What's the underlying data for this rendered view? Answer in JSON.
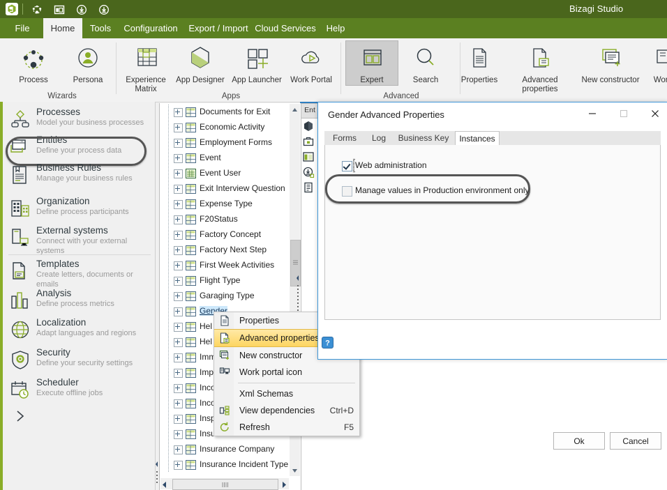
{
  "app": {
    "title": "Bizagi Studio",
    "titlebar_icons": [
      "bizagi-logo-icon",
      "process-icon",
      "window-layout-icon",
      "download-icon",
      "download-alt-icon"
    ]
  },
  "ribbon": {
    "tabs": [
      {
        "label": "File",
        "active": false
      },
      {
        "label": "Home",
        "active": true
      },
      {
        "label": "Tools",
        "active": false
      },
      {
        "label": "Configuration",
        "active": false
      },
      {
        "label": "Export / Import",
        "active": false
      },
      {
        "label": "Cloud Services",
        "active": false
      },
      {
        "label": "Help",
        "active": false
      }
    ],
    "groups": [
      {
        "label": "Wizards"
      },
      {
        "label": "Apps"
      },
      {
        "label": "Advanced"
      },
      {
        "label": ""
      }
    ],
    "items": [
      {
        "label": "Process",
        "icon": "process-nodes-icon",
        "selected": false
      },
      {
        "label": "Persona",
        "icon": "persona-icon",
        "selected": false
      },
      {
        "label": "Experience Matrix",
        "icon": "matrix-grid-icon",
        "selected": false
      },
      {
        "label": "App Designer",
        "icon": "hexagon-designer-icon",
        "selected": false
      },
      {
        "label": "App Launcher",
        "icon": "squares-plus-icon",
        "selected": false
      },
      {
        "label": "Work Portal",
        "icon": "cloud-play-icon",
        "selected": false
      },
      {
        "label": "Expert",
        "icon": "expert-panes-icon",
        "selected": true
      },
      {
        "label": "Search",
        "icon": "search-icon",
        "selected": false
      },
      {
        "label": "Properties",
        "icon": "document-lines-icon",
        "selected": false
      },
      {
        "label": "Advanced properties",
        "icon": "document-advanced-icon",
        "selected": false
      },
      {
        "label": "New constructor",
        "icon": "new-constructor-icon",
        "selected": false
      },
      {
        "label": "Work",
        "icon": "work-portal-icon-icon",
        "selected": false
      }
    ]
  },
  "sidebar": {
    "items": [
      {
        "title": "Processes",
        "subtitle": "Model your business processes",
        "icon": "processes-icon",
        "highlighted": false
      },
      {
        "title": "Entities",
        "subtitle": "Define your process data",
        "icon": "entities-icon",
        "highlighted": true
      },
      {
        "title": "Business Rules",
        "subtitle": "Manage your business rules",
        "icon": "business-rules-icon",
        "highlighted": false
      },
      {
        "title": "Organization",
        "subtitle": "Define process participants",
        "icon": "organization-icon",
        "highlighted": false
      },
      {
        "title": "External systems",
        "subtitle": "Connect with your external systems",
        "icon": "external-systems-icon",
        "highlighted": false
      },
      {
        "title": "Templates",
        "subtitle": "Create letters, documents  or emails",
        "icon": "templates-icon",
        "highlighted": false
      },
      {
        "title": "Analysis",
        "subtitle": "Define  process  metrics",
        "icon": "analysis-icon",
        "highlighted": false
      },
      {
        "title": "Localization",
        "subtitle": "Adapt  languages  and regions",
        "icon": "localization-icon",
        "highlighted": false
      },
      {
        "title": "Security",
        "subtitle": "Define  your  security  settings",
        "icon": "security-icon",
        "highlighted": false
      },
      {
        "title": "Scheduler",
        "subtitle": "Execute offline  jobs",
        "icon": "scheduler-icon",
        "highlighted": false
      }
    ],
    "expand_icon": "chevron-right-icon"
  },
  "tree": {
    "nodes": [
      {
        "label": "Documents for Exit",
        "icon": "entity-table-icon",
        "selected": false
      },
      {
        "label": "Economic Activity",
        "icon": "entity-table-icon",
        "selected": false
      },
      {
        "label": "Employment Forms",
        "icon": "entity-table-icon",
        "selected": false
      },
      {
        "label": "Event",
        "icon": "entity-table-icon",
        "selected": false
      },
      {
        "label": "Event User",
        "icon": "entity-system-icon",
        "selected": false
      },
      {
        "label": "Exit Interview Question",
        "icon": "entity-table-icon",
        "selected": false
      },
      {
        "label": "Expense Type",
        "icon": "entity-table-icon",
        "selected": false
      },
      {
        "label": "F20Status",
        "icon": "entity-table-icon",
        "selected": false
      },
      {
        "label": "Factory Concept",
        "icon": "entity-table-icon",
        "selected": false
      },
      {
        "label": "Factory Next Step",
        "icon": "entity-table-icon",
        "selected": false
      },
      {
        "label": "First Week Activities",
        "icon": "entity-table-icon",
        "selected": false
      },
      {
        "label": "Flight Type",
        "icon": "entity-table-icon",
        "selected": false
      },
      {
        "label": "Garaging Type",
        "icon": "entity-table-icon",
        "selected": false
      },
      {
        "label": "Gender",
        "icon": "entity-table-icon",
        "selected": true
      },
      {
        "label": "Hel",
        "icon": "entity-table-icon",
        "selected": false
      },
      {
        "label": "Hel",
        "icon": "entity-table-icon",
        "selected": false
      },
      {
        "label": "Imm",
        "icon": "entity-table-icon",
        "selected": false
      },
      {
        "label": "Imp",
        "icon": "entity-table-icon",
        "selected": false
      },
      {
        "label": "Inco",
        "icon": "entity-table-icon",
        "selected": false
      },
      {
        "label": "Inco",
        "icon": "entity-table-icon",
        "selected": false
      },
      {
        "label": "Insp",
        "icon": "entity-table-icon",
        "selected": false
      },
      {
        "label": "Insurance Cancellation",
        "icon": "entity-table-icon",
        "selected": false
      },
      {
        "label": "Insurance Company",
        "icon": "entity-table-icon",
        "selected": false
      },
      {
        "label": "Insurance Incident Type",
        "icon": "entity-table-icon",
        "selected": false
      }
    ]
  },
  "mini_toolbar": {
    "tab_label": "Ent",
    "icons": [
      "hexagon-solid-icon",
      "briefcase-icon",
      "panes-icon",
      "download-circle-icon",
      "list-document-icon"
    ]
  },
  "context_menu": {
    "items": [
      {
        "label": "Properties",
        "shortcut": "",
        "icon": "document-lines-icon",
        "highlighted": false,
        "separator_after": false
      },
      {
        "label": "Advanced properties",
        "shortcut": "",
        "icon": "document-advanced-icon",
        "highlighted": true,
        "separator_after": false
      },
      {
        "label": "New constructor",
        "shortcut": "",
        "icon": "new-constructor-icon",
        "highlighted": false,
        "separator_after": false
      },
      {
        "label": "Work portal icon",
        "shortcut": "",
        "icon": "work-portal-icon-icon",
        "highlighted": false,
        "separator_after": true
      },
      {
        "label": "Xml Schemas",
        "shortcut": "",
        "icon": "",
        "highlighted": false,
        "separator_after": false
      },
      {
        "label": "View dependencies",
        "shortcut": "Ctrl+D",
        "icon": "dependencies-icon",
        "highlighted": false,
        "separator_after": false
      },
      {
        "label": "Refresh",
        "shortcut": "F5",
        "icon": "refresh-icon",
        "highlighted": false,
        "separator_after": false
      }
    ]
  },
  "dialog": {
    "title": "Gender Advanced Properties",
    "window_buttons": [
      {
        "name": "minimize",
        "glyph": "—"
      },
      {
        "name": "maximize",
        "glyph": "□"
      },
      {
        "name": "close",
        "glyph": "✕"
      }
    ],
    "tabs": [
      {
        "label": "Forms",
        "active": false
      },
      {
        "label": "Log",
        "active": false
      },
      {
        "label": "Business Key",
        "active": false
      },
      {
        "label": "Instances",
        "active": true
      }
    ],
    "checkboxes": [
      {
        "label": "Web administration",
        "checked": true,
        "focused": true,
        "highlighted": false
      },
      {
        "label": "Manage values in Production environment only",
        "checked": false,
        "focused": false,
        "highlighted": true
      }
    ],
    "help_icon": "help-question-icon",
    "buttons": [
      {
        "label": "Ok",
        "name": "ok-button"
      },
      {
        "label": "Cancel",
        "name": "cancel-button"
      }
    ]
  },
  "colors": {
    "titlebar": "#4a661c",
    "ribbon_tabs": "#5b8021",
    "accent_green": "#8aad28",
    "dialog_border": "#3f97d8",
    "highlight_yellow": "#fdd561",
    "selection_blue": "#cde8fb"
  }
}
